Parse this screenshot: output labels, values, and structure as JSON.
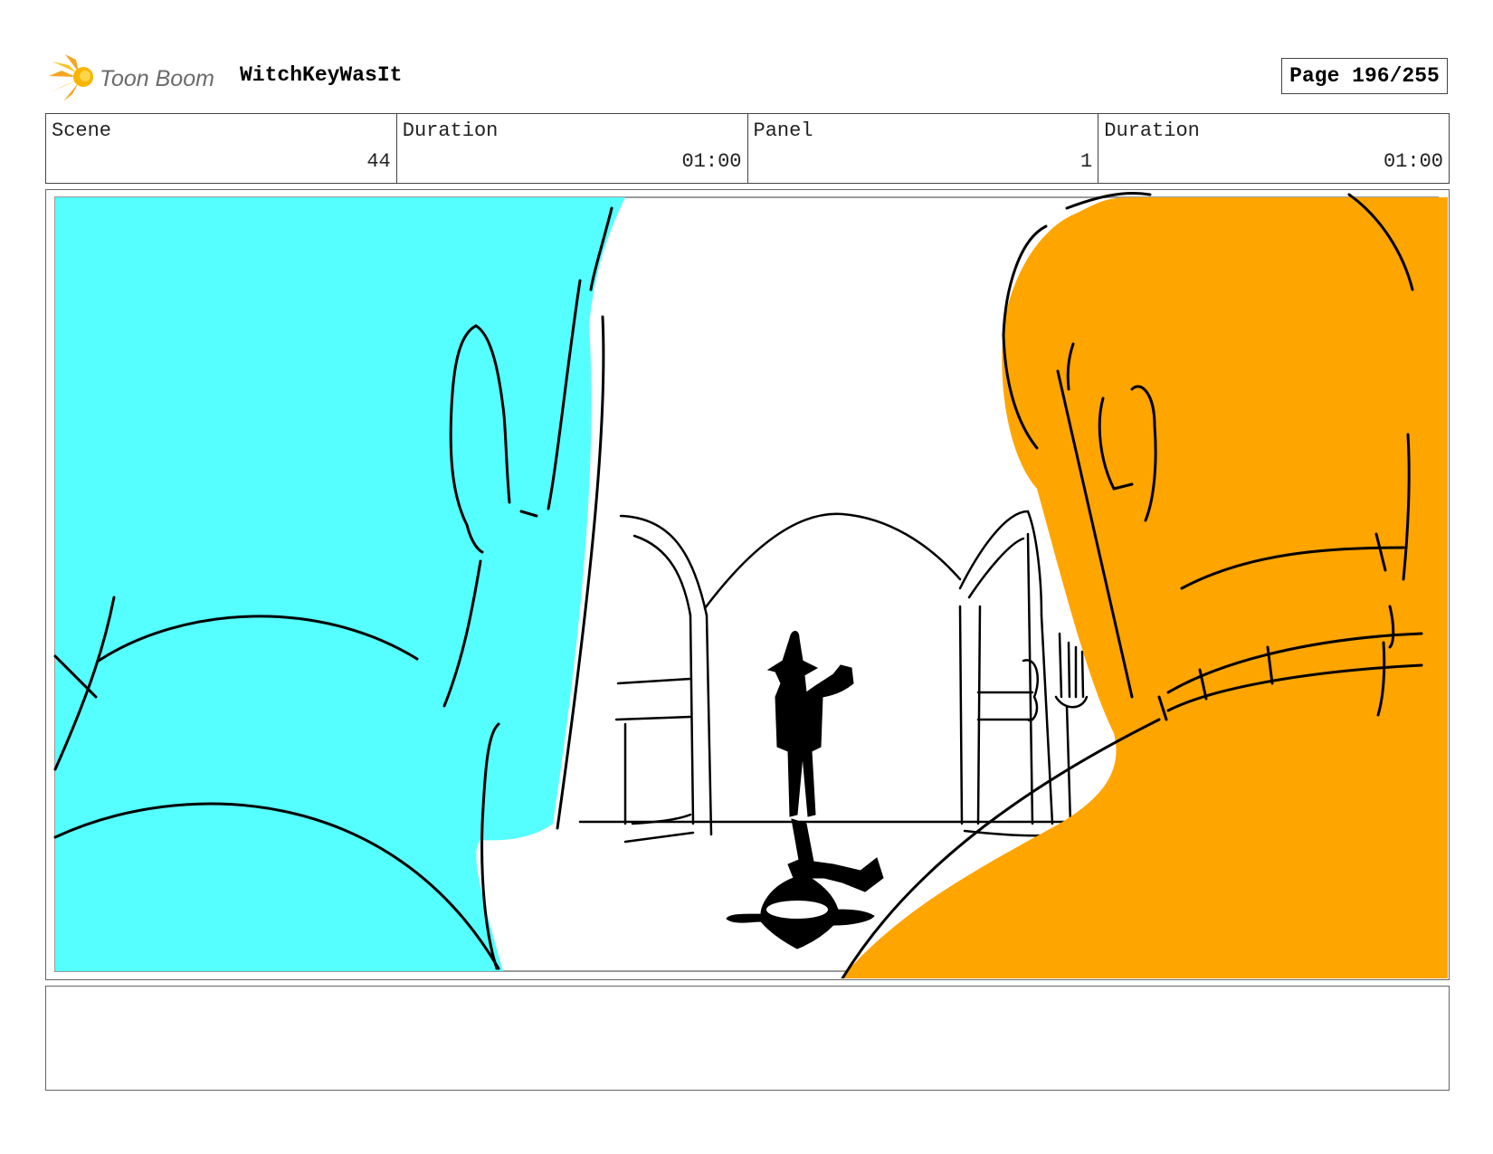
{
  "header": {
    "logo_text": "Toon Boom",
    "project_title": "WitchKeyWasIt",
    "page_label": "Page 196/255"
  },
  "info": {
    "scene_label": "Scene",
    "scene_value": "44",
    "scene_duration_label": "Duration",
    "scene_duration_value": "01:00",
    "panel_label": "Panel",
    "panel_value": "1",
    "panel_duration_label": "Duration",
    "panel_duration_value": "01:00"
  },
  "notes": {
    "text": ""
  },
  "colors": {
    "left_character": "#55FFFF",
    "right_character": "#FFA500",
    "ink": "#000000"
  }
}
